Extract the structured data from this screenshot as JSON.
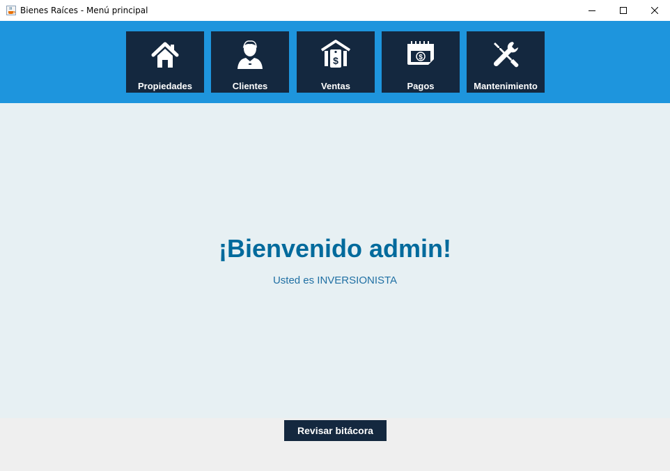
{
  "window": {
    "title": "Bienes Raíces - Menú principal",
    "app_icon": "java-coffee-icon",
    "controls": [
      "minimize-icon",
      "maximize-icon",
      "close-icon"
    ]
  },
  "nav": {
    "items": [
      {
        "label": "Propiedades",
        "icon": "house-icon"
      },
      {
        "label": "Clientes",
        "icon": "user-icon"
      },
      {
        "label": "Ventas",
        "icon": "house-dollar-icon"
      },
      {
        "label": "Pagos",
        "icon": "calendar-money-icon"
      },
      {
        "label": "Mantenimiento",
        "icon": "tools-icon"
      }
    ]
  },
  "main": {
    "welcome": "¡Bienvenido admin!",
    "role": "Usted es INVERSIONISTA"
  },
  "footer": {
    "log_button": "Revisar bitácora"
  },
  "colors": {
    "toolbar_bg": "#1e95dd",
    "button_bg": "#14283f",
    "main_bg": "#e7f0f3",
    "welcome_text": "#006a9c",
    "role_text": "#1f6fa3"
  }
}
